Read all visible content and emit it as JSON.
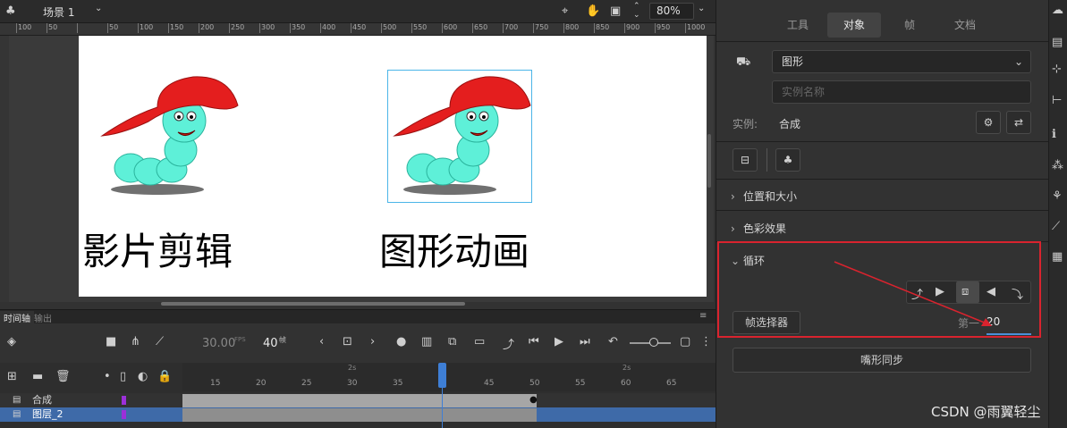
{
  "topbar": {
    "scene_label": "场景 1",
    "zoom_value": "80%"
  },
  "ruler": {
    "ticks": [
      "100",
      "50",
      "",
      "50",
      "100",
      "150",
      "200",
      "250",
      "300",
      "350",
      "400",
      "450",
      "500",
      "550",
      "600",
      "650",
      "700",
      "750",
      "800",
      "850",
      "900",
      "950",
      "1000"
    ]
  },
  "stage": {
    "label_left": "影片剪辑",
    "label_right": "图形动画"
  },
  "timeline": {
    "tab_timeline": "时间轴",
    "tab_output": "输出",
    "fps_value": "30.00",
    "fps_unit": "FPS",
    "frame_value": "40",
    "frame_unit": "帧",
    "frame_numbers": [
      "15",
      "20",
      "25",
      "30",
      "35",
      "",
      "45",
      "50",
      "55",
      "60",
      "65"
    ],
    "seconds_markers": [
      "2s",
      "2s"
    ],
    "layers": [
      {
        "name": "合成"
      },
      {
        "name": "图层_2"
      }
    ]
  },
  "properties": {
    "tabs": [
      "工具",
      "对象",
      "帧",
      "文档"
    ],
    "active_tab": "对象",
    "symbol_type": "图形",
    "instance_name_placeholder": "实例名称",
    "instance_label": "实例:",
    "instance_value": "合成",
    "sections": {
      "position_size": "位置和大小",
      "color_effect": "色彩效果",
      "loop": "循环"
    },
    "frame_picker_label": "帧选择器",
    "first_label": "第一",
    "first_value": "20",
    "lip_sync_label": "嘴形同步"
  },
  "watermark": "CSDN @雨翼轻尘",
  "colors": {
    "accent": "#4a90d9",
    "annotation_red": "#d9232e",
    "playhead": "#3e7fd6",
    "layer_purple": "#9b30d9"
  }
}
